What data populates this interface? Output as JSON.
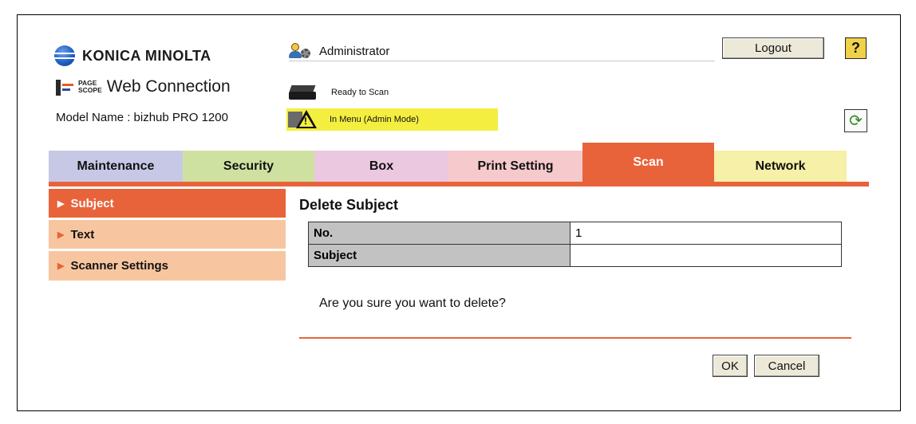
{
  "header": {
    "brand": "KONICA MINOLTA",
    "product_small_top": "PAGE",
    "product_small_bottom": "SCOPE",
    "product_title": "Web Connection",
    "model_name": "Model Name : bizhub PRO 1200",
    "user": "Administrator",
    "logout_label": "Logout",
    "help_label": "?",
    "status_ready": "Ready to Scan",
    "status_menu": "In Menu (Admin Mode)",
    "refresh_icon": "refresh-icon"
  },
  "tabs": [
    {
      "label": "Maintenance",
      "color": "#c7c8e6"
    },
    {
      "label": "Security",
      "color": "#cfe1a1"
    },
    {
      "label": "Box",
      "color": "#ebc7e0"
    },
    {
      "label": "Print Setting",
      "color": "#f6c9cc"
    },
    {
      "label": "Scan",
      "color": "#e9633a",
      "active": true
    },
    {
      "label": "Network",
      "color": "#f6f0a8"
    }
  ],
  "sidebar": {
    "items": [
      {
        "label": "Subject",
        "active": true
      },
      {
        "label": "Text",
        "active": false
      },
      {
        "label": "Scanner Settings",
        "active": false
      }
    ]
  },
  "main": {
    "title": "Delete Subject",
    "table": [
      {
        "header": "No.",
        "value": "1"
      },
      {
        "header": "Subject",
        "value": ""
      }
    ],
    "confirm_text": "Are you sure you want to delete?",
    "ok_label": "OK",
    "cancel_label": "Cancel"
  },
  "colors": {
    "accent": "#e9633a",
    "status_highlight": "#f4ee40"
  }
}
